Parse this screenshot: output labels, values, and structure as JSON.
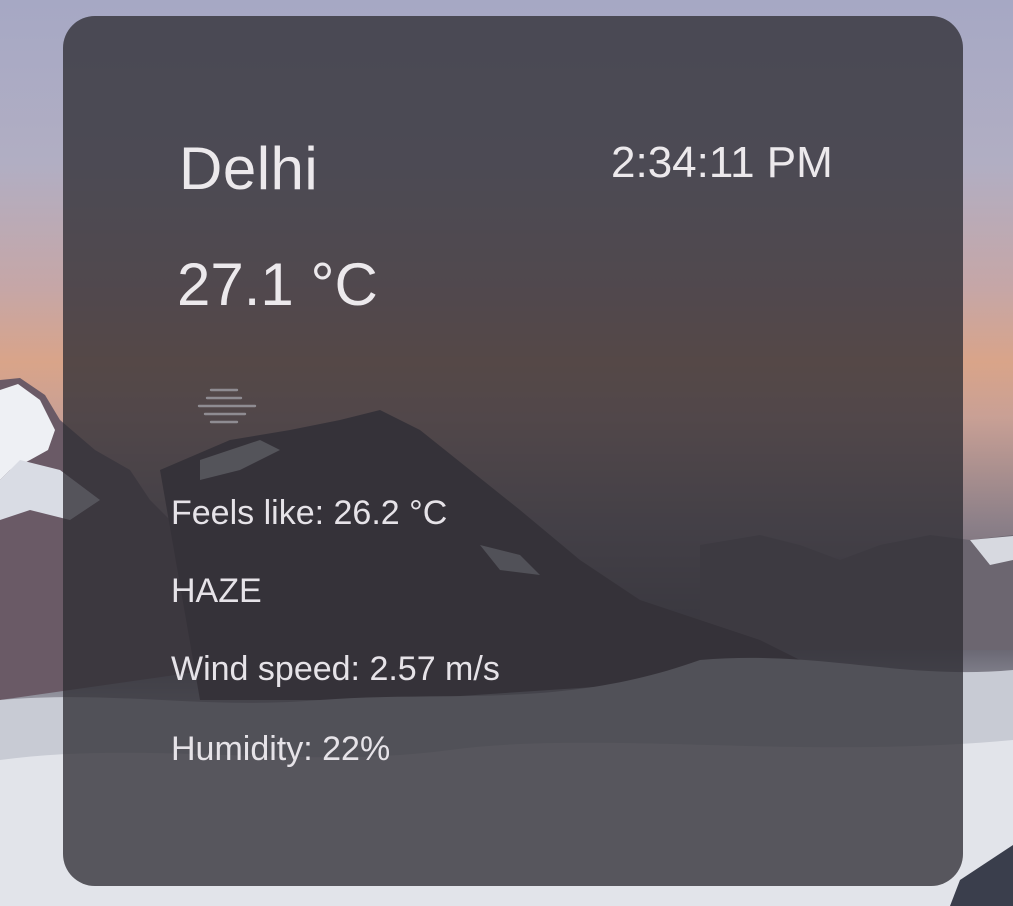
{
  "weather": {
    "city": "Delhi",
    "time": "2:34:11 PM",
    "temperature": "27.1 °C",
    "icon": "haze-icon",
    "feels_like": "Feels like: 26.2 °C",
    "condition": "HAZE",
    "wind_speed": "Wind speed: 2.57 m/s",
    "humidity": "Humidity: 22%"
  },
  "colors": {
    "card_background": "#302e34",
    "text": "#ece9ec"
  }
}
